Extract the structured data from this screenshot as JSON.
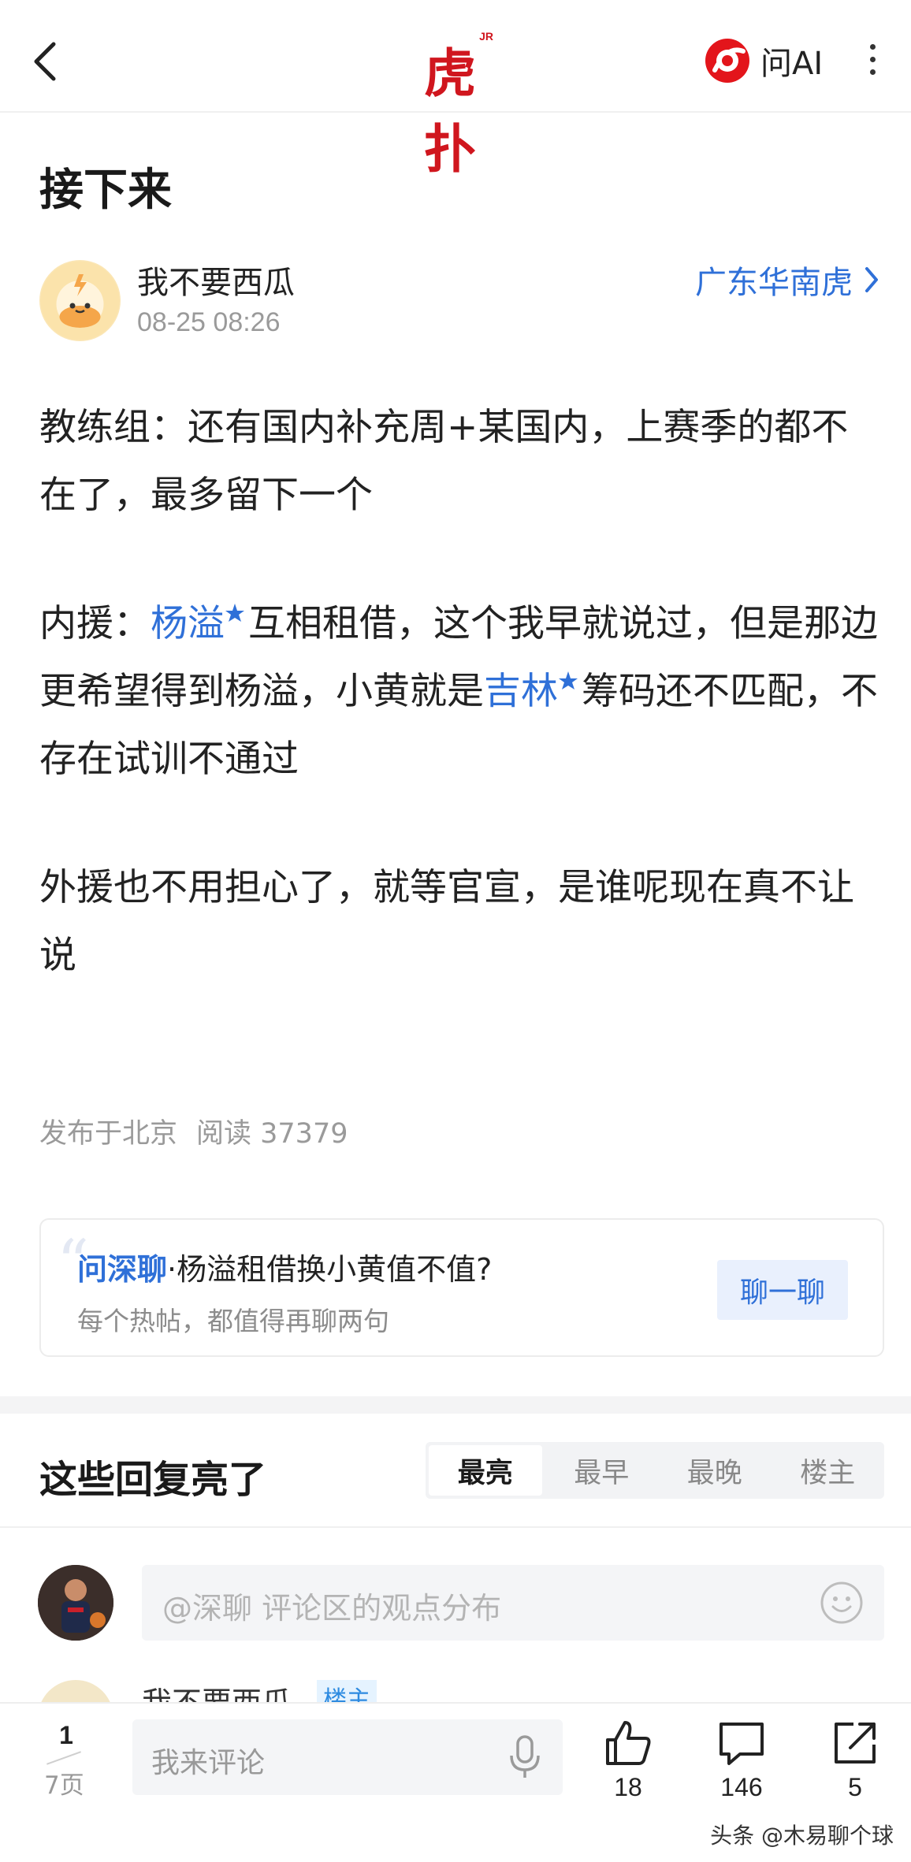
{
  "header": {
    "logo_text": "虎扑",
    "logo_badge": "JR",
    "ai_label": "问AI"
  },
  "post": {
    "title": "接下来",
    "author": "我不要西瓜",
    "time": "08-25 08:26",
    "forum": "广东华南虎",
    "paragraphs": {
      "p1": "教练组：还有国内补充周+某国内，上赛季的都不在了，最多留下一个",
      "p2_a": "内援：",
      "p2_tag1": "杨溢",
      "p2_b": "互相租借，这个我早就说过，但是那边更希望得到杨溢，小黄就是",
      "p2_tag2": "吉林",
      "p2_c": "筹码还不匹配，不存在试训不通过",
      "p3": "外援也不用担心了，就等官宣，是谁呢现在真不让说"
    },
    "location": "发布于北京",
    "reads": "阅读 37379"
  },
  "ai_card": {
    "brand": "问深聊",
    "question": "·杨溢租借换小黄值不值?",
    "subtitle": "每个热帖，都值得再聊两句",
    "button": "聊一聊"
  },
  "replies": {
    "title": "这些回复亮了",
    "tabs": [
      "最亮",
      "最早",
      "最晚",
      "楼主"
    ],
    "active_tab": "最亮",
    "prompt_placeholder": "@深聊 评论区的观点分布",
    "peek_name": "我不要西瓜",
    "peek_badge": "楼主"
  },
  "bottom": {
    "page_current": "1",
    "page_total": "7页",
    "comment_placeholder": "我来评论",
    "likes": "18",
    "comments": "146",
    "shares": "5"
  },
  "watermark": "头条 @木易聊个球",
  "colors": {
    "brand_red": "#d0161e",
    "link_blue": "#2f70d8"
  }
}
